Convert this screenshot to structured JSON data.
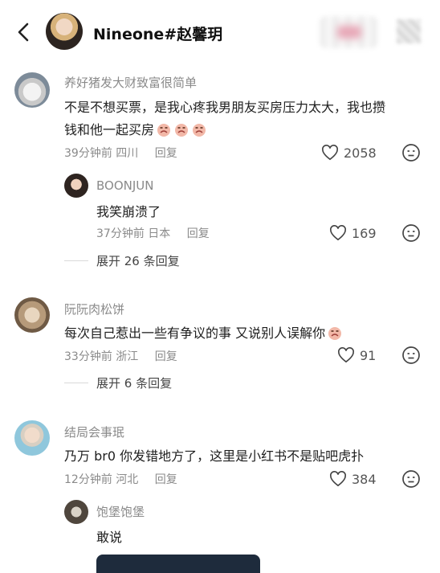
{
  "header": {
    "title": "Nineone#赵馨玥"
  },
  "comments": [
    {
      "user": "养好猪发大财致富很简单",
      "text": "不是不想买票，是我心疼我男朋友买房压力太大，我也攒钱和他一起买房",
      "emoji": "crying-face-emoji",
      "time": "39分钟前",
      "location": "四川",
      "reply_label": "回复",
      "likes": "2058",
      "replies": [
        {
          "user": "BOONJUN",
          "text": "我笑崩溃了",
          "time": "37分钟前",
          "location": "日本",
          "reply_label": "回复",
          "likes": "169"
        }
      ],
      "expand_label": "展开 26 条回复"
    },
    {
      "user": "阮阮肉松饼",
      "text": "每次自己惹出一些有争议的事 又说别人误解你",
      "emoji": "crying-face-emoji",
      "time": "33分钟前",
      "location": "浙江",
      "reply_label": "回复",
      "likes": "91",
      "expand_label": "展开 6 条回复"
    },
    {
      "user": "结局会事珉",
      "text": "乃万 br0 你发错地方了，这里是小红书不是贴吧虎扑",
      "time": "12分钟前",
      "location": "河北",
      "reply_label": "回复",
      "likes": "384",
      "replies": [
        {
          "user": "饱堡饱堡",
          "text": "敢说"
        }
      ]
    }
  ]
}
